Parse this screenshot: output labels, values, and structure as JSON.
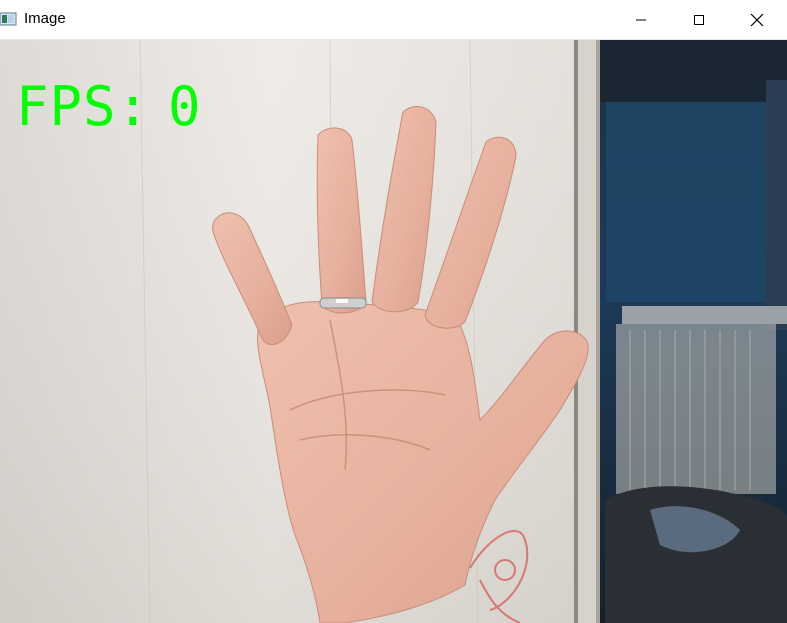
{
  "window": {
    "title": "Image",
    "icon": "opencv-window-icon",
    "controls": {
      "minimize": "minimize-icon",
      "maximize": "maximize-icon",
      "close": "close-icon"
    }
  },
  "overlay": {
    "fps_label": "FPS:",
    "fps_value": "0",
    "color": "#00ff00"
  },
  "colors": {
    "titlebar": "#ffffff",
    "wall": "#e4e1dc",
    "dark_room": "#1c2a3a",
    "skin": "#e9b7a5"
  }
}
